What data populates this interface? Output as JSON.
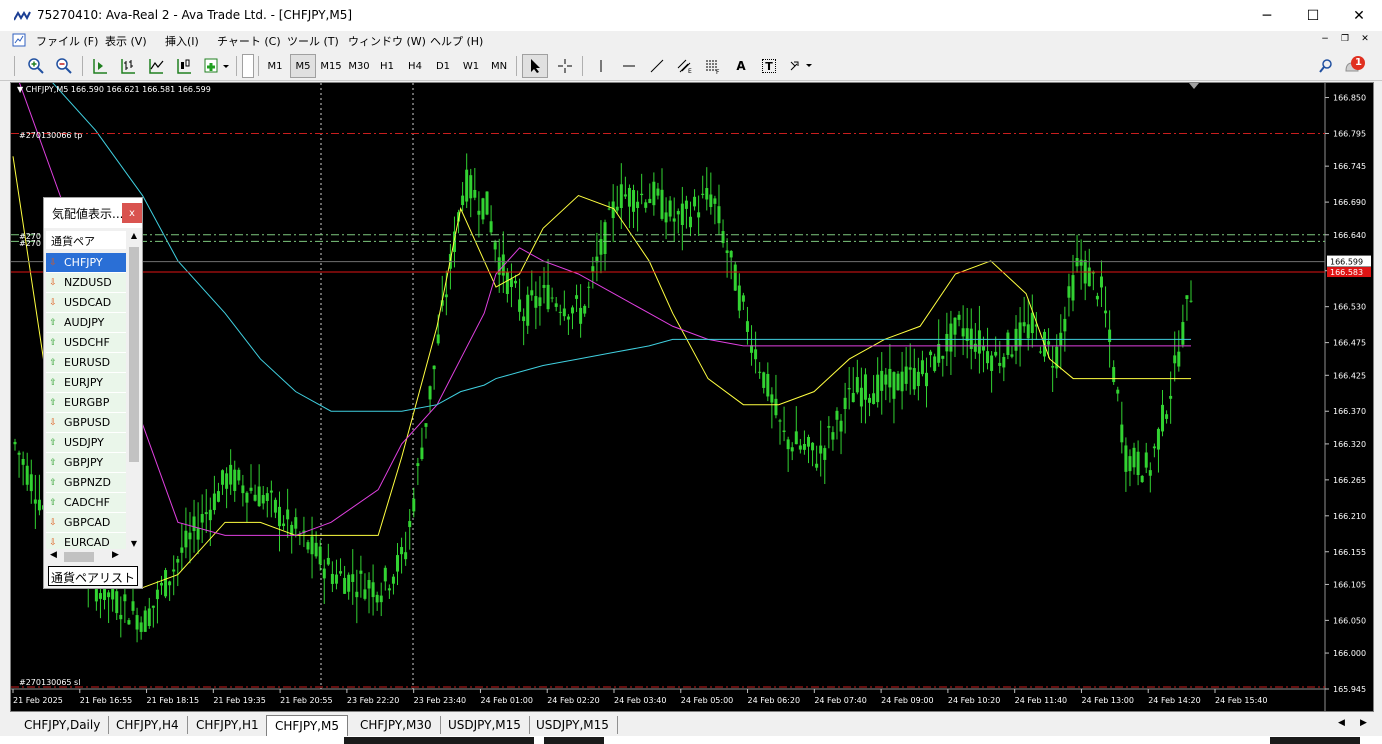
{
  "window": {
    "title": "75270410: Ava-Real 2 - Ava Trade Ltd. - [CHFJPY,M5]",
    "minimize": "─",
    "maximize": "☐",
    "close": "✕"
  },
  "menu": {
    "items": [
      "ファイル (F)",
      "表示 (V)",
      "挿入(I)",
      "チャート (C)",
      "ツール (T)",
      "ウィンドウ (W)",
      "ヘルプ (H)"
    ],
    "right_minimize": "−",
    "right_restore": "❐",
    "right_close": "✕"
  },
  "toolbar": {
    "timeframes": [
      "M1",
      "M5",
      "M15",
      "M30",
      "H1",
      "H4",
      "D1",
      "W1",
      "MN"
    ],
    "active_timeframe": "M5",
    "notification_count": "1",
    "text_tool": "A",
    "label_tool": "T"
  },
  "chart": {
    "header": "CHFJPY,M5  166.590 166.621 166.581 166.599",
    "tp_label": "#270130066 tp",
    "sl_label": "#270130065 sl",
    "entry_label_1": "#270",
    "entry_label_2": "#270",
    "current_price": "166.599",
    "red_line_price": "166.583",
    "colors": {
      "background": "#000000",
      "candle": "#32d232",
      "ma_fast": "#ffff40",
      "ma_mid": "#e040e0",
      "ma_slow": "#40d0e0",
      "stop_line": "#c81e1e",
      "price_line": "#e01414",
      "entry_lines": "#7ec87e"
    }
  },
  "chart_data": {
    "type": "candlestick",
    "symbol": "CHFJPY",
    "timeframe": "M5",
    "open": 166.59,
    "high": 166.621,
    "low": 166.581,
    "close": 166.599,
    "y_ticks": [
      "166.850",
      "166.795",
      "166.745",
      "166.690",
      "166.640",
      "166.585",
      "166.530",
      "166.475",
      "166.425",
      "166.370",
      "166.320",
      "166.265",
      "166.210",
      "166.155",
      "166.105",
      "166.050",
      "166.000",
      "165.945"
    ],
    "x_ticks": [
      "21 Feb 2025",
      "21 Feb 16:55",
      "21 Feb 18:15",
      "21 Feb 19:35",
      "21 Feb 20:55",
      "23 Feb 22:20",
      "23 Feb 23:40",
      "24 Feb 01:00",
      "24 Feb 02:20",
      "24 Feb 03:40",
      "24 Feb 05:00",
      "24 Feb 06:20",
      "24 Feb 07:40",
      "24 Feb 09:00",
      "24 Feb 10:20",
      "24 Feb 11:40",
      "24 Feb 13:00",
      "24 Feb 14:20",
      "24 Feb 15:40"
    ],
    "ylim": [
      165.945,
      166.86
    ],
    "close_path_x": [
      0,
      0.03,
      0.07,
      0.11,
      0.14,
      0.18,
      0.21,
      0.24,
      0.27,
      0.31,
      0.33,
      0.36,
      0.38,
      0.4,
      0.41,
      0.43,
      0.45,
      0.48,
      0.51,
      0.54,
      0.56,
      0.59,
      0.62,
      0.65,
      0.68,
      0.71,
      0.74,
      0.77,
      0.8,
      0.83,
      0.86,
      0.88,
      0.9,
      0.92,
      0.94,
      0.96,
      0.98,
      1.0
    ],
    "close_path": [
      166.32,
      166.2,
      166.1,
      166.05,
      166.15,
      166.27,
      166.24,
      166.18,
      166.12,
      166.1,
      166.15,
      166.5,
      166.72,
      166.68,
      166.6,
      166.52,
      166.55,
      166.52,
      166.7,
      166.7,
      166.66,
      166.7,
      166.5,
      166.33,
      166.3,
      166.4,
      166.41,
      166.43,
      166.5,
      166.45,
      166.5,
      166.45,
      166.6,
      166.55,
      166.3,
      166.28,
      166.42,
      166.6
    ],
    "ma_fast": [
      166.76,
      166.4,
      166.22,
      166.1,
      166.12,
      166.2,
      166.2,
      166.18,
      166.18,
      166.18,
      166.3,
      166.5,
      166.68,
      166.6,
      166.56,
      166.58,
      166.65,
      166.7,
      166.68,
      166.6,
      166.52,
      166.42,
      166.38,
      166.38,
      166.4,
      166.45,
      166.48,
      166.5,
      166.58,
      166.6,
      166.55,
      166.45,
      166.42,
      166.42,
      166.42,
      166.42,
      166.42,
      166.42
    ],
    "ma_mid": [
      166.9,
      166.75,
      166.55,
      166.35,
      166.2,
      166.18,
      166.18,
      166.18,
      166.2,
      166.25,
      166.32,
      166.38,
      166.45,
      166.52,
      166.58,
      166.62,
      166.6,
      166.58,
      166.55,
      166.52,
      166.5,
      166.48,
      166.47,
      166.47,
      166.47,
      166.47,
      166.47,
      166.47,
      166.47,
      166.47,
      166.47,
      166.47,
      166.47,
      166.47,
      166.47,
      166.47,
      166.47,
      166.47
    ],
    "ma_slow": [
      166.95,
      166.88,
      166.8,
      166.7,
      166.6,
      166.52,
      166.45,
      166.4,
      166.37,
      166.37,
      166.37,
      166.38,
      166.4,
      166.41,
      166.42,
      166.43,
      166.44,
      166.45,
      166.46,
      166.47,
      166.48,
      166.48,
      166.48,
      166.48,
      166.48,
      166.48,
      166.48,
      166.48,
      166.48,
      166.48,
      166.48,
      166.48,
      166.48,
      166.48,
      166.48,
      166.48,
      166.48,
      166.48
    ],
    "levels": {
      "tp": 166.795,
      "sl": 165.945,
      "entry": [
        166.64,
        166.63
      ],
      "bid": 166.599,
      "red_line": 166.583
    }
  },
  "market_watch": {
    "title": "気配値表示...",
    "close_label": "x",
    "column_header": "通貨ペア",
    "tab_label": "通貨ペアリスト",
    "rows": [
      {
        "symbol": "CHFJPY",
        "direction": "down",
        "selected": true
      },
      {
        "symbol": "NZDUSD",
        "direction": "down",
        "selected": false
      },
      {
        "symbol": "USDCAD",
        "direction": "down",
        "selected": false
      },
      {
        "symbol": "AUDJPY",
        "direction": "up",
        "selected": false
      },
      {
        "symbol": "USDCHF",
        "direction": "up",
        "selected": false
      },
      {
        "symbol": "EURUSD",
        "direction": "up",
        "selected": false
      },
      {
        "symbol": "EURJPY",
        "direction": "up",
        "selected": false
      },
      {
        "symbol": "EURGBP",
        "direction": "up",
        "selected": false
      },
      {
        "symbol": "GBPUSD",
        "direction": "down",
        "selected": false
      },
      {
        "symbol": "USDJPY",
        "direction": "up",
        "selected": false
      },
      {
        "symbol": "GBPJPY",
        "direction": "up",
        "selected": false
      },
      {
        "symbol": "GBPNZD",
        "direction": "up",
        "selected": false
      },
      {
        "symbol": "CADCHF",
        "direction": "up",
        "selected": false
      },
      {
        "symbol": "GBPCAD",
        "direction": "down",
        "selected": false
      },
      {
        "symbol": "EURCAD",
        "direction": "down",
        "selected": false
      }
    ]
  },
  "chart_tabs": [
    {
      "label": "CHFJPY,Daily",
      "active": false
    },
    {
      "label": "CHFJPY,H4",
      "active": false
    },
    {
      "label": "CHFJPY,H1",
      "active": false
    },
    {
      "label": "CHFJPY,M5",
      "active": true
    },
    {
      "label": "CHFJPY,M30",
      "active": false
    },
    {
      "label": "USDJPY,M15",
      "active": false
    },
    {
      "label": "USDJPY,M15",
      "active": false
    }
  ]
}
